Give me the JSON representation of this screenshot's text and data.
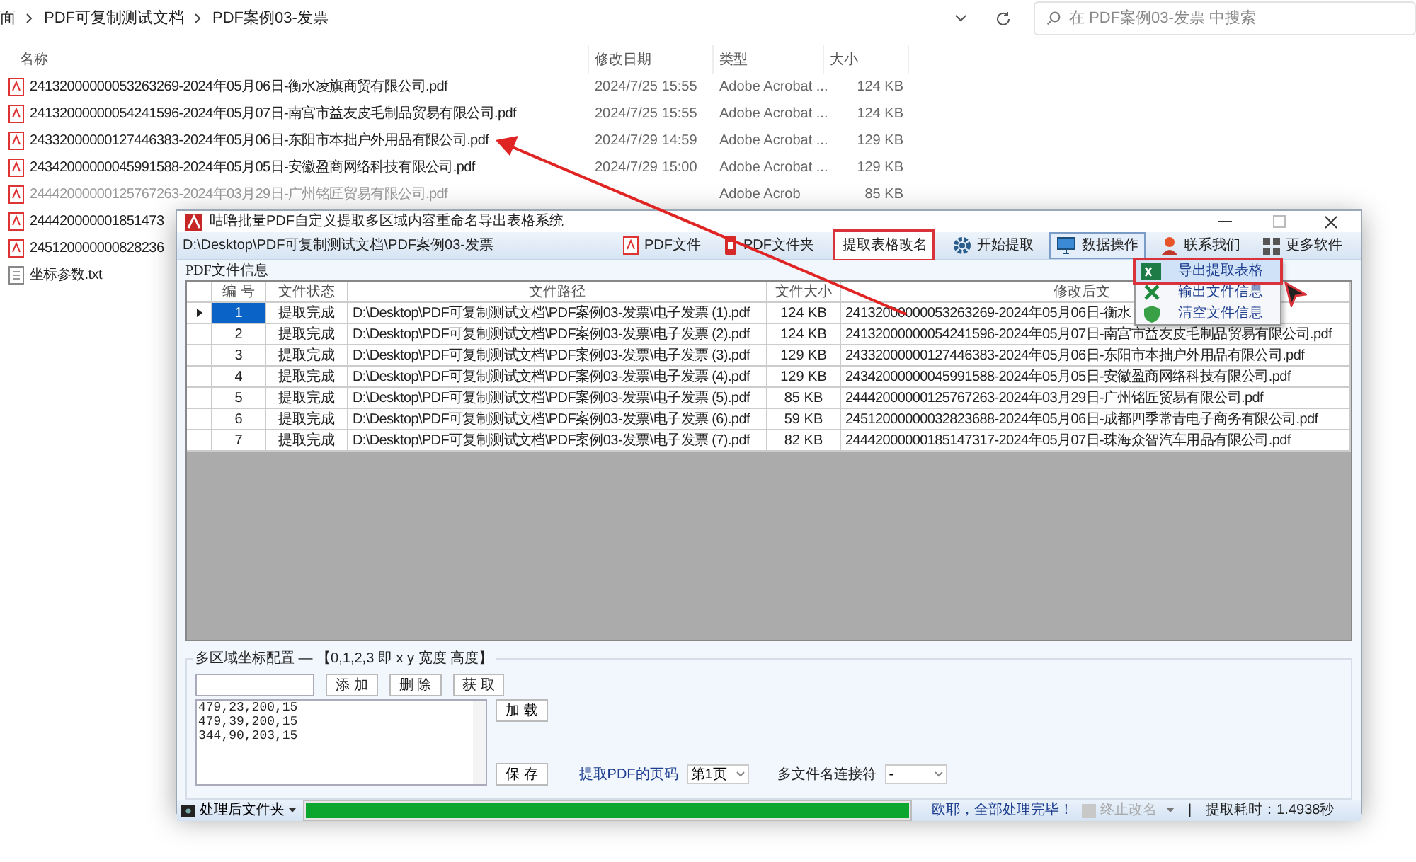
{
  "explorer": {
    "breadcrumb": [
      "面",
      "PDF可复制测试文档",
      "PDF案例03-发票"
    ],
    "search": {
      "placeholder": "在 PDF案例03-发票 中搜索"
    },
    "columns": [
      "名称",
      "修改日期",
      "类型",
      "大小"
    ],
    "files": [
      {
        "kind": "pdf",
        "name": "24132000000053263269-2024年05月06日-衡水凌旗商贸有限公司.pdf",
        "date": "2024/7/25 15:55",
        "type": "Adobe Acrobat ...",
        "size": "124 KB"
      },
      {
        "kind": "pdf",
        "name": "24132000000054241596-2024年05月07日-南宫市益友皮毛制品贸易有限公司.pdf",
        "date": "2024/7/25 15:55",
        "type": "Adobe Acrobat ...",
        "size": "124 KB"
      },
      {
        "kind": "pdf",
        "name": "24332000000127446383-2024年05月06日-东阳市本拙户外用品有限公司.pdf",
        "date": "2024/7/29 14:59",
        "type": "Adobe Acrobat ...",
        "size": "129 KB"
      },
      {
        "kind": "pdf",
        "name": "24342000000045991588-2024年05月05日-安徽盈商网络科技有限公司.pdf",
        "date": "2024/7/29 15:00",
        "type": "Adobe Acrobat ...",
        "size": "129 KB"
      },
      {
        "kind": "pdf",
        "name": "24442000000125767263-2024年03月29日-广州铭匠贸易有限公司.pdf",
        "type": "Adobe Acrob",
        "size": "85 KB"
      },
      {
        "kind": "pdf",
        "name": "244420000001851473"
      },
      {
        "kind": "pdf",
        "name": "245120000000828236"
      },
      {
        "kind": "txt",
        "name": "坐标参数.txt"
      }
    ]
  },
  "app": {
    "title": "咕噜批量PDF自定义提取多区域内容重命名导出表格系统",
    "path": "D:\\Desktop\\PDF可复制测试文档\\PDF案例03-发票",
    "toolbar": [
      {
        "kind": "button",
        "label": "PDF文件",
        "pressed": false,
        "annotated": false
      },
      {
        "kind": "button",
        "label": "PDF文件夹",
        "pressed": false,
        "annotated": false
      },
      {
        "kind": "dropdown",
        "label": "提取表格改名",
        "pressed": false,
        "annotated": true
      },
      {
        "kind": "button",
        "label": "开始提取",
        "pressed": false,
        "annotated": false
      },
      {
        "kind": "button",
        "label": "数据操作",
        "pressed": true,
        "annotated": false
      },
      {
        "kind": "button",
        "label": "联系我们",
        "pressed": false,
        "annotated": false
      },
      {
        "kind": "button",
        "label": "更多软件",
        "pressed": false,
        "annotated": false
      }
    ],
    "group_label": "PDF文件信息",
    "table": {
      "columns": [
        "编 号",
        "文件状态",
        "文件路径",
        "文件大小",
        "修改后文"
      ],
      "rows": [
        {
          "selected": true,
          "cells": [
            "1",
            "提取完成",
            "D:\\Desktop\\PDF可复制测试文档\\PDF案例03-发票\\电子发票 (1).pdf",
            "124 KB",
            "24132000000053263269-2024年05月06日-衡水"
          ]
        },
        {
          "selected": false,
          "cells": [
            "2",
            "提取完成",
            "D:\\Desktop\\PDF可复制测试文档\\PDF案例03-发票\\电子发票 (2).pdf",
            "124 KB",
            "24132000000054241596-2024年05月07日-南宫市益友皮毛制品贸易有限公司.pdf"
          ]
        },
        {
          "selected": false,
          "cells": [
            "3",
            "提取完成",
            "D:\\Desktop\\PDF可复制测试文档\\PDF案例03-发票\\电子发票 (3).pdf",
            "129 KB",
            "24332000000127446383-2024年05月06日-东阳市本拙户外用品有限公司.pdf"
          ]
        },
        {
          "selected": false,
          "cells": [
            "4",
            "提取完成",
            "D:\\Desktop\\PDF可复制测试文档\\PDF案例03-发票\\电子发票 (4).pdf",
            "129 KB",
            "24342000000045991588-2024年05月05日-安徽盈商网络科技有限公司.pdf"
          ]
        },
        {
          "selected": false,
          "cells": [
            "5",
            "提取完成",
            "D:\\Desktop\\PDF可复制测试文档\\PDF案例03-发票\\电子发票 (5).pdf",
            "85 KB",
            "24442000000125767263-2024年03月29日-广州铭匠贸易有限公司.pdf"
          ]
        },
        {
          "selected": false,
          "cells": [
            "6",
            "提取完成",
            "D:\\Desktop\\PDF可复制测试文档\\PDF案例03-发票\\电子发票 (6).pdf",
            "59 KB",
            "24512000000032823688-2024年05月06日-成都四季常青电子商务有限公司.pdf"
          ]
        },
        {
          "selected": false,
          "cells": [
            "7",
            "提取完成",
            "D:\\Desktop\\PDF可复制测试文档\\PDF案例03-发票\\电子发票 (7).pdf",
            "82 KB",
            "24442000000185147317-2024年05月07日-珠海众智汽车用品有限公司.pdf"
          ]
        }
      ]
    },
    "menu": {
      "items": [
        {
          "label": "导出提取表格",
          "selected": true,
          "annotated": true
        },
        {
          "label": "输出文件信息",
          "selected": false,
          "annotated": false
        },
        {
          "label": "清空文件信息",
          "selected": false,
          "annotated": false
        }
      ]
    },
    "coords": {
      "legend": "多区域坐标配置 — 【0,1,2,3 即 x y 宽度 高度】",
      "buttons": [
        "添 加",
        "删 除",
        "获 取"
      ],
      "lines": [
        "479,23,200,15",
        "479,39,200,15",
        "344,90,203,15"
      ],
      "load_button": "加 载",
      "save_button": "保 存",
      "page_label": "提取PDF的页码",
      "page_value": "第1页",
      "joiner_label": "多文件名连接符",
      "joiner_value": "-"
    },
    "status": {
      "folder_button": "处理后文件夹",
      "progress": {
        "level": 1
      },
      "message": "欧耶，全部处理完毕！",
      "stop": {
        "label": "终止改名",
        "disabled": true
      },
      "separator": "|",
      "elapsed": "提取耗时：1.4938秒"
    }
  }
}
